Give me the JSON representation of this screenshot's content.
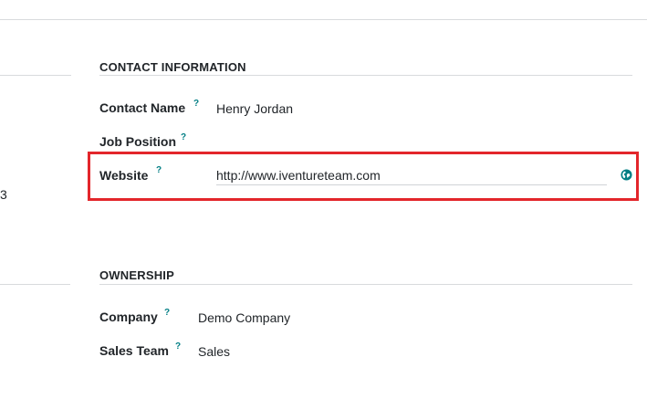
{
  "left_column": {
    "partial_text": "3"
  },
  "contact_section": {
    "title": "CONTACT INFORMATION",
    "contact_name": {
      "label": "Contact Name",
      "help": "?",
      "value": "Henry Jordan"
    },
    "job_position": {
      "label": "Job Position",
      "help": "?",
      "value": ""
    },
    "website": {
      "label": "Website",
      "help": "?",
      "value": "http://www.iventureteam.com",
      "link_icon": "globe-icon"
    }
  },
  "ownership_section": {
    "title": "OWNERSHIP",
    "company": {
      "label": "Company",
      "help": "?",
      "value": "Demo Company"
    },
    "sales_team": {
      "label": "Sales Team",
      "help": "?",
      "value": "Sales"
    }
  },
  "colors": {
    "accent": "#017e84",
    "highlight": "#e3262b",
    "divider": "#d8dadd",
    "text": "#212529"
  }
}
